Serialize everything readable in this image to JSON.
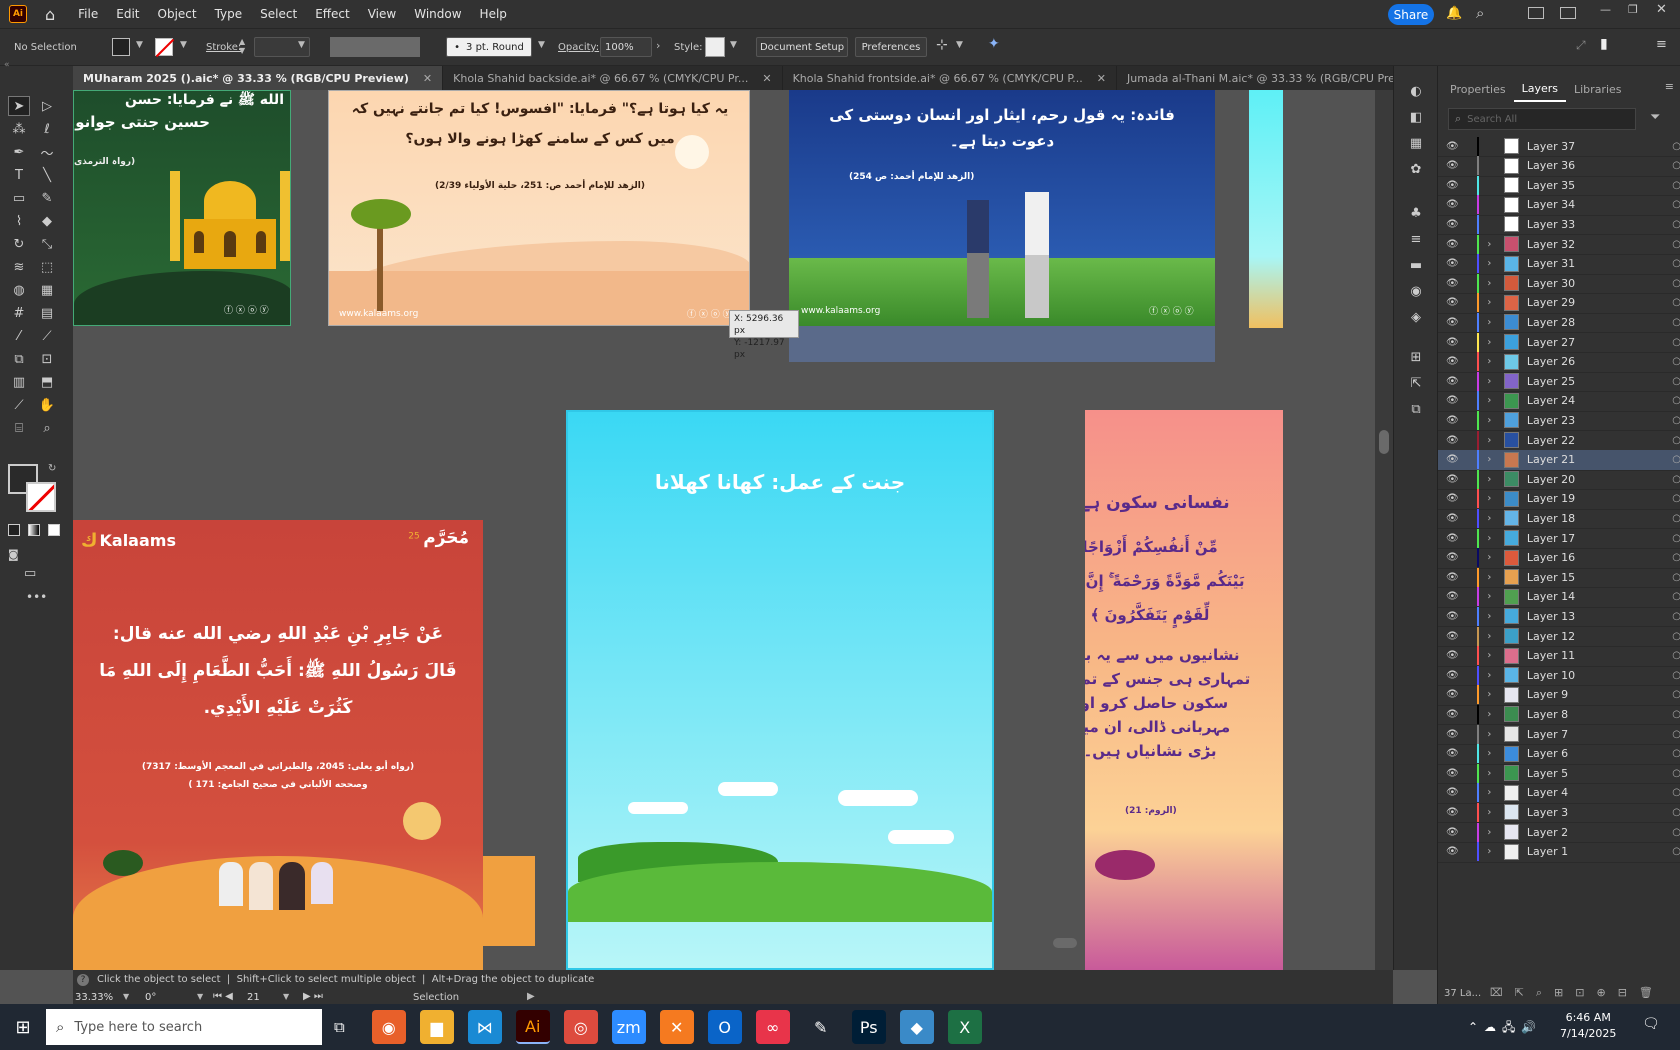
{
  "menubar": {
    "app_icon": "Ai",
    "items": [
      "File",
      "Edit",
      "Object",
      "Type",
      "Select",
      "Effect",
      "View",
      "Window",
      "Help"
    ],
    "share": "Share"
  },
  "control": {
    "selection": "No Selection",
    "stroke_label": "Stroke:",
    "brush": "3 pt. Round",
    "opacity_label": "Opacity:",
    "opacity": "100%",
    "style_label": "Style:",
    "doc_setup": "Document Setup",
    "preferences": "Preferences"
  },
  "tabs": [
    {
      "label": "MUharam 2025 ().aic* @ 33.33 % (RGB/CPU Preview)",
      "active": true
    },
    {
      "label": "Khola Shahid backside.ai* @ 66.67 % (CMYK/CPU Pr...",
      "active": false
    },
    {
      "label": "Khola Shahid frontside.ai* @ 66.67 % (CMYK/CPU P...",
      "active": false
    },
    {
      "label": "Jumada al-Thani M.aic* @ 33.33 % (RGB/CPU Pre...",
      "active": false
    }
  ],
  "artboards": {
    "green": {
      "line1": "الله ﷺ نے فرمایا: حسن",
      "line2": "حسین جنتی جوانوں",
      "source": "(رواہ الترمذی"
    },
    "peach": {
      "line1": "یہ کیا ہوتا ہے؟\" فرمایا: \"افسوس! کیا تم جانتے نہیں کہ",
      "line2": "میں کس کے سامنے کھڑا ہونے والا ہوں؟",
      "ref": "(الزهد للإمام أحمد ص: 251، حلية الأولياء 2/39)",
      "web": "www.kalaams.org"
    },
    "blue": {
      "line1": "فائدہ: یہ قول رحم، ایثار اور انسان دوستی کی",
      "line2": "دعوت دیتا ہے۔",
      "ref": "(الزهد للإمام أحمد: ص 254)",
      "web": "www.kalaams.org"
    },
    "red": {
      "brand": "Kalaams",
      "muharram": "مُحَرَّم",
      "day": "25",
      "hadith1": "عَنْ جَابِرِ بْنِ عَبْدِ اللهِ رضي الله عنه قال:",
      "hadith2": "قَالَ رَسُولُ اللهِ ﷺ: أَحَبُّ الطَّعَامِ إِلَى اللهِ مَا",
      "hadith3": "كَثُرَتْ عَلَيْهِ الأَيْدِي.",
      "ref1": "(رواه أبو يعلى: 2045، والطبراني في المعجم الأوسط: 7317)",
      "ref2": "وصححه الألباني في صحيح الجامع: 171 )"
    },
    "cyan": {
      "title": "جنت کے عمل: کھانا کھلانا"
    },
    "sunset": {
      "title": "نفسانی سکون ہے",
      "ayah1": "مِّنْ أَنفُسِكُمْ أَزْوَاجًا",
      "ayah2": "بَيْنَكُم مَّوَدَّةً وَرَحْمَةً ۚ إِنَّ فِي",
      "ayah3": "لِّقَوْمٍ يَتَفَكَّرُونَ ﴾",
      "u1": "نشانیوں میں سے یہ بھی",
      "u2": "تمہاری ہی جنس کے تمہارے",
      "u3": "سکون حاصل کرو اور",
      "u4": "مہربانی ڈالی، ان میں",
      "u5": "بڑی نشانیاں ہیں۔",
      "ref": "(الروم: 21)"
    }
  },
  "tooltip": {
    "x": "X: 5296.36 px",
    "y": "Y: -1217.97 px"
  },
  "panel": {
    "tabs": [
      "Properties",
      "Layers",
      "Libraries"
    ],
    "search_placeholder": "Search All",
    "footer": "37 La..."
  },
  "layers": [
    {
      "name": "Layer 37",
      "color": "#000000",
      "thumb": "#ffffff",
      "chev": false
    },
    {
      "name": "Layer 36",
      "color": "#7f7f7f",
      "thumb": "#ffffff",
      "chev": false
    },
    {
      "name": "Layer 35",
      "color": "#4fe6e6",
      "thumb": "#ffffff",
      "chev": false
    },
    {
      "name": "Layer 34",
      "color": "#c83ce6",
      "thumb": "#ffffff",
      "chev": false
    },
    {
      "name": "Layer 33",
      "color": "#4f7fff",
      "thumb": "#ffffff",
      "chev": false
    },
    {
      "name": "Layer 32",
      "color": "#4fe64f",
      "thumb": "#c8506e",
      "chev": true
    },
    {
      "name": "Layer 31",
      "color": "#4f4fff",
      "thumb": "#5ab4e6",
      "chev": true
    },
    {
      "name": "Layer 30",
      "color": "#4fe64f",
      "thumb": "#d25a3c",
      "chev": true
    },
    {
      "name": "Layer 29",
      "color": "#ff9a2a",
      "thumb": "#dc6446",
      "chev": true
    },
    {
      "name": "Layer 28",
      "color": "#4f7fff",
      "thumb": "#3c8cd2",
      "chev": true
    },
    {
      "name": "Layer 27",
      "color": "#ffe64f",
      "thumb": "#3ca0dc",
      "chev": true
    },
    {
      "name": "Layer 26",
      "color": "#ff4f4f",
      "thumb": "#6ec8e6",
      "chev": true
    },
    {
      "name": "Layer 25",
      "color": "#c83ce6",
      "thumb": "#8264c8",
      "chev": true
    },
    {
      "name": "Layer 24",
      "color": "#4f7fff",
      "thumb": "#3c9650",
      "chev": true
    },
    {
      "name": "Layer 23",
      "color": "#4fe64f",
      "thumb": "#4fa0dc",
      "chev": true
    },
    {
      "name": "Layer 22",
      "color": "#9a1e32",
      "thumb": "#2850a0",
      "chev": true
    },
    {
      "name": "Layer 21",
      "color": "#4f7fff",
      "thumb": "#c87850",
      "chev": true
    },
    {
      "name": "Layer 20",
      "color": "#4fe64f",
      "thumb": "#3c8c64",
      "chev": true
    },
    {
      "name": "Layer 19",
      "color": "#ff4f4f",
      "thumb": "#3c8cc8",
      "chev": true
    },
    {
      "name": "Layer 18",
      "color": "#4f4fff",
      "thumb": "#64b4e6",
      "chev": true
    },
    {
      "name": "Layer 17",
      "color": "#4fe64f",
      "thumb": "#46aadc",
      "chev": true
    },
    {
      "name": "Layer 16",
      "color": "#0a0a64",
      "thumb": "#dc5a3c",
      "chev": true
    },
    {
      "name": "Layer 15",
      "color": "#ff9a2a",
      "thumb": "#e6a050",
      "chev": true
    },
    {
      "name": "Layer 14",
      "color": "#c83ce6",
      "thumb": "#50a050",
      "chev": true
    },
    {
      "name": "Layer 13",
      "color": "#4f7fff",
      "thumb": "#46aadc",
      "chev": true
    },
    {
      "name": "Layer 12",
      "color": "#c89650",
      "thumb": "#3ca0c8",
      "chev": true
    },
    {
      "name": "Layer 11",
      "color": "#ff4f4f",
      "thumb": "#dc6e8c",
      "chev": true
    },
    {
      "name": "Layer 10",
      "color": "#4f4fff",
      "thumb": "#5ab4e6",
      "chev": true
    },
    {
      "name": "Layer 9",
      "color": "#ff9a2a",
      "thumb": "#e6e6f0",
      "chev": true
    },
    {
      "name": "Layer 8",
      "color": "#000000",
      "thumb": "#3c8c50",
      "chev": true
    },
    {
      "name": "Layer 7",
      "color": "#7f7f7f",
      "thumb": "#e6e6e6",
      "chev": true
    },
    {
      "name": "Layer 6",
      "color": "#4fe6e6",
      "thumb": "#3c8cdc",
      "chev": true
    },
    {
      "name": "Layer 5",
      "color": "#4fe64f",
      "thumb": "#3c9650",
      "chev": true
    },
    {
      "name": "Layer 4",
      "color": "#4f7fff",
      "thumb": "#f0f0f0",
      "chev": true
    },
    {
      "name": "Layer 3",
      "color": "#ff4f4f",
      "thumb": "#dce6f0",
      "chev": true
    },
    {
      "name": "Layer 2",
      "color": "#c83ce6",
      "thumb": "#e6e6f0",
      "chev": true
    },
    {
      "name": "Layer 1",
      "color": "#4f4fff",
      "thumb": "#f0f0f0",
      "chev": true
    }
  ],
  "selected_layer": "Layer 21",
  "status": {
    "hint": "Click the object to select  |  Shift+Click to select multiple object  |  Alt+Drag the object to duplicate",
    "zoom": "33.33%",
    "rotation": "0°",
    "artboard": "21",
    "mode": "Selection"
  },
  "taskbar": {
    "search": "Type here to search",
    "time": "6:46 AM",
    "date": "7/14/2025",
    "icons": [
      "firefox-icon",
      "file-explorer-icon",
      "vscode-icon",
      "illustrator-icon",
      "chrome-icon",
      "zoom-icon",
      "xampp-icon",
      "outlook-icon",
      "creative-cloud-icon",
      "pen-tool-icon",
      "photoshop-icon",
      "app-icon",
      "excel-icon"
    ]
  }
}
